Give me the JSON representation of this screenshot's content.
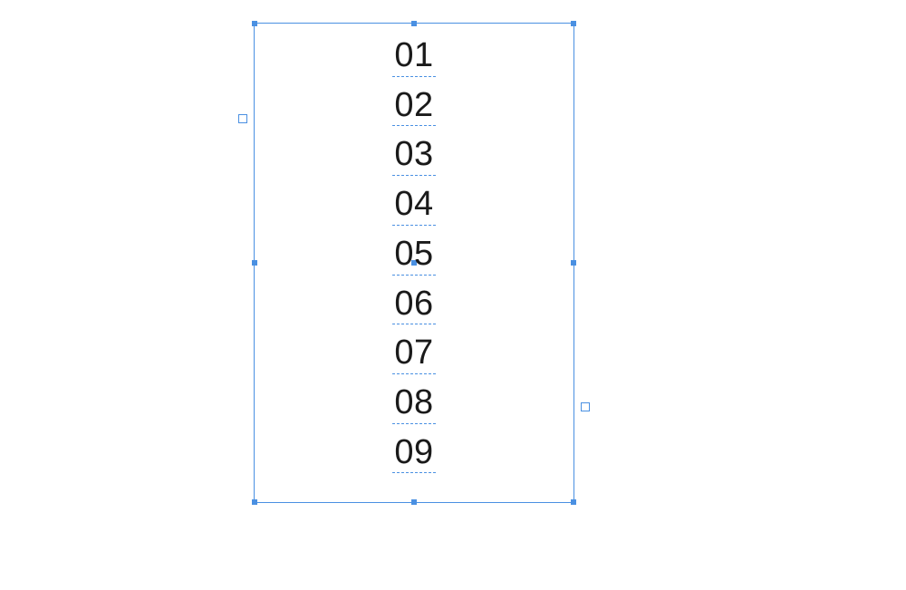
{
  "textFrame": {
    "lines": [
      "01",
      "02",
      "03",
      "04",
      "05",
      "06",
      "07",
      "08",
      "09"
    ]
  }
}
